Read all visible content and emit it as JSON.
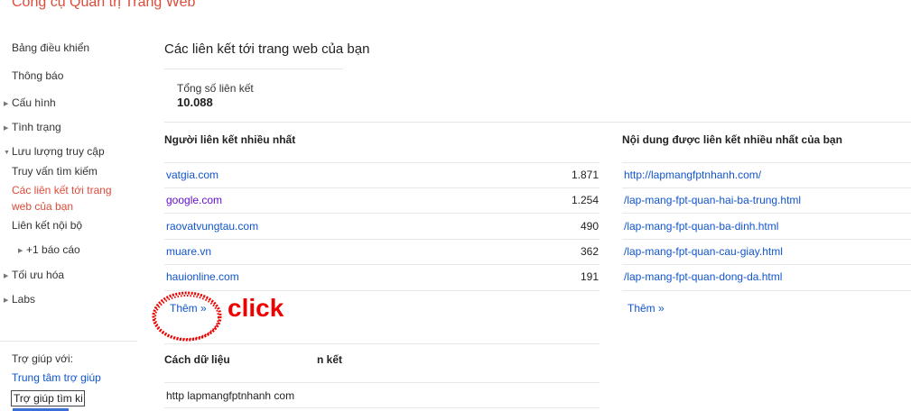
{
  "app_title": "Công cụ Quản trị Trang Web",
  "sidebar": {
    "items": [
      {
        "label": "Bảng điều khiển"
      },
      {
        "label": "Thông báo"
      },
      {
        "label": "Cấu hình"
      },
      {
        "label": "Tình trạng"
      },
      {
        "label": "Lưu lượng truy cập"
      },
      {
        "label": "Truy vấn tìm kiếm"
      },
      {
        "label": "Các liên kết tới trang web của bạn"
      },
      {
        "label": "Liên kết nội bộ"
      },
      {
        "label": "+1 báo cáo"
      },
      {
        "label": "Tối ưu hóa"
      },
      {
        "label": "Labs"
      }
    ],
    "active_line1": "Các liên kết tới trang",
    "active_line2": "web của bạn",
    "help_title": "Trợ giúp với:",
    "help_link": "Trung tâm trợ giúp",
    "help_input_value": "Trợ giúp tìm ki",
    "active_color": "#dd4b39",
    "link_color": "#1155cc"
  },
  "main": {
    "title": "Các liên kết tới trang web của bạn",
    "total_label": "Tổng số liên kết",
    "total_value": "10.088",
    "top_linkers": {
      "heading": "Người liên kết nhiều nhất",
      "rows": [
        {
          "domain": "vatgia.com",
          "count": "1.871"
        },
        {
          "domain": "google.com",
          "count": "1.254"
        },
        {
          "domain": "raovatvungtau.com",
          "count": "490"
        },
        {
          "domain": "muare.vn",
          "count": "362"
        },
        {
          "domain": "hauionline.com",
          "count": "191"
        }
      ],
      "more": "Thêm »"
    },
    "top_content": {
      "heading": "Nội dung được liên kết nhiều nhất của bạn",
      "rows": [
        {
          "url": "http://lapmangfptnhanh.com/"
        },
        {
          "url": "/lap-mang-fpt-quan-hai-ba-trung.html"
        },
        {
          "url": "/lap-mang-fpt-quan-ba-dinh.html"
        },
        {
          "url": "/lap-mang-fpt-quan-cau-giay.html"
        },
        {
          "url": "/lap-mang-fpt-quan-dong-da.html"
        }
      ],
      "more": "Thêm »"
    },
    "how_data": {
      "heading_part1": "Cách dữ liệu",
      "heading_part2": "n kết",
      "row": "http lapmangfptnhanh com"
    },
    "annotation": "click"
  }
}
